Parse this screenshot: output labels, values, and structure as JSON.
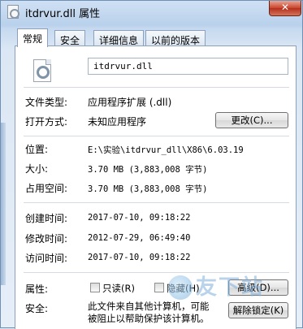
{
  "window": {
    "title": "itdrvur.dll 属性",
    "close_glyph": "✕"
  },
  "tabs": [
    {
      "label": "常规",
      "active": true
    },
    {
      "label": "安全",
      "active": false
    },
    {
      "label": "详细信息",
      "active": false
    },
    {
      "label": "以前的版本",
      "active": false
    }
  ],
  "general": {
    "file_name": "itdrvur.dll",
    "rows": {
      "type_label": "文件类型:",
      "type_value": "应用程序扩展 (.dll)",
      "open_label": "打开方式:",
      "open_value": "未知应用程序",
      "change_button": "更改(C)...",
      "location_label": "位置:",
      "location_value": "E:\\实验\\itdrvur_dll\\X86\\6.03.19",
      "size_label": "大小:",
      "size_value": "3.70 MB (3,883,008 字节)",
      "disk_label": "占用空间:",
      "disk_value": "3.70 MB (3,883,008 字节)",
      "created_label": "创建时间:",
      "created_value": "2017-07-10, 09:18:22",
      "modified_label": "修改时间:",
      "modified_value": "2012-07-29, 06:49:40",
      "accessed_label": "访问时间:",
      "accessed_value": "2017-07-10, 09:18:22",
      "attr_label": "属性:",
      "readonly_label": "只读(R)",
      "hidden_label": "隐藏(H)",
      "advanced_button": "高级(D)...",
      "security_label": "安全:",
      "security_text_1": "此文件来自其他计算机，可能",
      "security_text_2": "被阻止以帮助保护该计算机。",
      "unblock_button": "解除锁定(K)"
    }
  },
  "watermark": {
    "text": "友下站"
  }
}
